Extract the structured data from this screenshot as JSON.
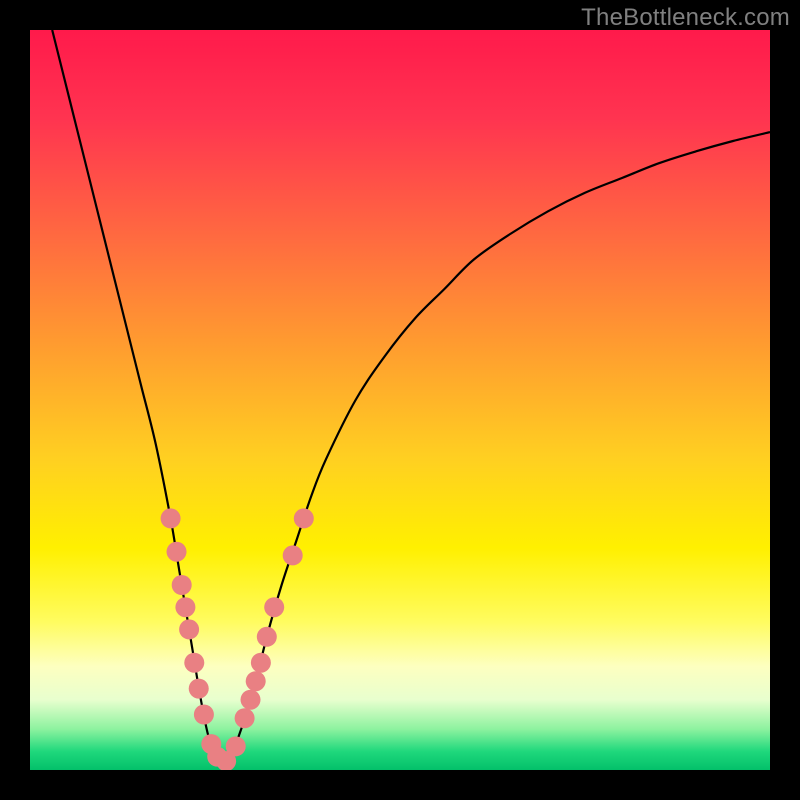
{
  "watermark": "TheBottleneck.com",
  "colors": {
    "gradient_stops": [
      {
        "offset": 0.0,
        "color": "#ff1a4b"
      },
      {
        "offset": 0.12,
        "color": "#ff3450"
      },
      {
        "offset": 0.28,
        "color": "#ff6a40"
      },
      {
        "offset": 0.42,
        "color": "#ff9a30"
      },
      {
        "offset": 0.58,
        "color": "#ffd021"
      },
      {
        "offset": 0.7,
        "color": "#fff000"
      },
      {
        "offset": 0.8,
        "color": "#fffc60"
      },
      {
        "offset": 0.86,
        "color": "#fdffc0"
      },
      {
        "offset": 0.905,
        "color": "#e8ffce"
      },
      {
        "offset": 0.945,
        "color": "#8cf29f"
      },
      {
        "offset": 0.975,
        "color": "#1fd87c"
      },
      {
        "offset": 1.0,
        "color": "#03c06a"
      }
    ],
    "curve": "#000000",
    "marker_fill": "#e98083",
    "marker_stroke": "#c55f63",
    "frame_bg": "#000000"
  },
  "chart_data": {
    "type": "line",
    "title": "",
    "xlabel": "",
    "ylabel": "",
    "xlim": [
      0,
      100
    ],
    "ylim": [
      0,
      100
    ],
    "grid": false,
    "legend": false,
    "series": [
      {
        "name": "bottleneck-curve",
        "x": [
          3,
          5,
          7,
          9,
          11,
          13,
          15,
          17,
          19,
          20,
          21,
          22,
          23,
          24,
          25,
          26,
          27,
          28,
          30,
          32,
          34,
          36,
          38,
          40,
          44,
          48,
          52,
          56,
          60,
          65,
          70,
          75,
          80,
          85,
          90,
          95,
          100
        ],
        "y": [
          100,
          92,
          84,
          76,
          68,
          60,
          52,
          44,
          34,
          28,
          22,
          16,
          10,
          5,
          2,
          1,
          1.5,
          4,
          10,
          18,
          25,
          31,
          37,
          42,
          50,
          56,
          61,
          65,
          69,
          72.5,
          75.5,
          78,
          80,
          82,
          83.6,
          85,
          86.2
        ]
      }
    ],
    "markers": {
      "name": "highlighted-points",
      "points": [
        {
          "x": 19.0,
          "y": 34
        },
        {
          "x": 19.8,
          "y": 29.5
        },
        {
          "x": 20.5,
          "y": 25
        },
        {
          "x": 21.0,
          "y": 22
        },
        {
          "x": 21.5,
          "y": 19
        },
        {
          "x": 22.2,
          "y": 14.5
        },
        {
          "x": 22.8,
          "y": 11
        },
        {
          "x": 23.5,
          "y": 7.5
        },
        {
          "x": 24.5,
          "y": 3.5
        },
        {
          "x": 25.3,
          "y": 1.8
        },
        {
          "x": 26.5,
          "y": 1.2
        },
        {
          "x": 27.8,
          "y": 3.2
        },
        {
          "x": 29.0,
          "y": 7
        },
        {
          "x": 29.8,
          "y": 9.5
        },
        {
          "x": 30.5,
          "y": 12
        },
        {
          "x": 31.2,
          "y": 14.5
        },
        {
          "x": 32.0,
          "y": 18
        },
        {
          "x": 33.0,
          "y": 22
        },
        {
          "x": 35.5,
          "y": 29
        },
        {
          "x": 37.0,
          "y": 34
        }
      ],
      "radius": 10
    }
  }
}
